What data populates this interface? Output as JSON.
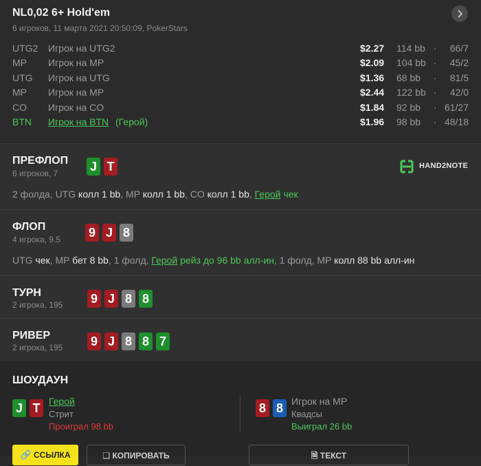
{
  "header": {
    "title": "NL0,02 6+ Hold'em",
    "subtitle": "6 игроков, 11 марта 2021 20:50:09, PokerStars",
    "players": [
      {
        "pos": "UTG2",
        "name": "Игрок на UTG2",
        "hero": "",
        "money": "$2.27",
        "bb": "114 bb",
        "stats": "66/7"
      },
      {
        "pos": "MP",
        "name": "Игрок на MP",
        "hero": "",
        "money": "$2.09",
        "bb": "104 bb",
        "stats": "45/2"
      },
      {
        "pos": "UTG",
        "name": "Игрок на UTG",
        "hero": "",
        "money": "$1.36",
        "bb": "68 bb",
        "stats": "81/5"
      },
      {
        "pos": "MP",
        "name": "Игрок на MP",
        "hero": "",
        "money": "$2.44",
        "bb": "122 bb",
        "stats": "42/0"
      },
      {
        "pos": "CO",
        "name": "Игрок на CO",
        "hero": "",
        "money": "$1.84",
        "bb": "92 bb",
        "stats": "61/27"
      },
      {
        "pos": "BTN",
        "name": "Игрок на BTN",
        "hero": "(Герой)",
        "money": "$1.96",
        "bb": "98 bb",
        "stats": "48/18"
      }
    ]
  },
  "preflop": {
    "title": "ПРЕФЛОП",
    "subtitle": "6 игроков, 7",
    "cards": [
      {
        "rank": "J",
        "suit": "green"
      },
      {
        "rank": "T",
        "suit": "red"
      }
    ],
    "logo": "HAND2NOTE",
    "actions": {
      "a1": "2 фолда, UTG ",
      "a2": "колл 1 bb",
      "a3": ", MP ",
      "a4": "колл 1 bb",
      "a5": ", CO ",
      "a6": "колл 1 bb",
      "a7": ", ",
      "a8": "Герой",
      "a9": " чек"
    }
  },
  "flop": {
    "title": "ФЛОП",
    "subtitle": "4 игрока, 9.5",
    "cards": [
      {
        "rank": "9",
        "suit": "red"
      },
      {
        "rank": "J",
        "suit": "red"
      },
      {
        "rank": "8",
        "suit": "grey"
      }
    ],
    "actions": {
      "a1": "UTG ",
      "a2": "чек",
      "a3": ", MP ",
      "a4": "бет 8 bb",
      "a5": ", 1 фолд, ",
      "a6": "Герой",
      "a7": " рейз до 96 bb алл-ин,",
      "a8": " 1 фолд, MP ",
      "a9": "колл 88 bb алл-ин"
    }
  },
  "turn": {
    "title": "ТУРН",
    "subtitle": "2 игрока, 195",
    "cards": [
      {
        "rank": "9",
        "suit": "red"
      },
      {
        "rank": "J",
        "suit": "red"
      },
      {
        "rank": "8",
        "suit": "grey"
      },
      {
        "rank": "8",
        "suit": "green"
      }
    ]
  },
  "river": {
    "title": "РИВЕР",
    "subtitle": "2 игрока, 195",
    "cards": [
      {
        "rank": "9",
        "suit": "red"
      },
      {
        "rank": "J",
        "suit": "red"
      },
      {
        "rank": "8",
        "suit": "grey"
      },
      {
        "rank": "8",
        "suit": "green"
      },
      {
        "rank": "7",
        "suit": "green"
      }
    ]
  },
  "showdown": {
    "title": "ШОУДАУН",
    "hero": {
      "cards": [
        {
          "rank": "J",
          "suit": "green"
        },
        {
          "rank": "T",
          "suit": "red"
        }
      ],
      "name": "Герой",
      "hand": "Стрит",
      "result": "Проиграл 98 bb"
    },
    "villain": {
      "cards": [
        {
          "rank": "8",
          "suit": "red"
        },
        {
          "rank": "8",
          "suit": "blue"
        }
      ],
      "name": "Игрок на MP",
      "hand": "Квадсы",
      "result": "Выиграл 26 bb"
    }
  },
  "buttons": {
    "link": "ССЫЛКА",
    "copy": "КОПИРОВАТЬ",
    "text": "ТЕКСТ"
  },
  "colors": {
    "background": "#2a2a2a",
    "green": "#4cc75a",
    "red": "#e0393a",
    "yellow": "#f5e21a",
    "card_red": "#a31c22",
    "card_green": "#1d8f2c",
    "card_grey": "#7b7b7b",
    "card_blue": "#1b5db5"
  }
}
